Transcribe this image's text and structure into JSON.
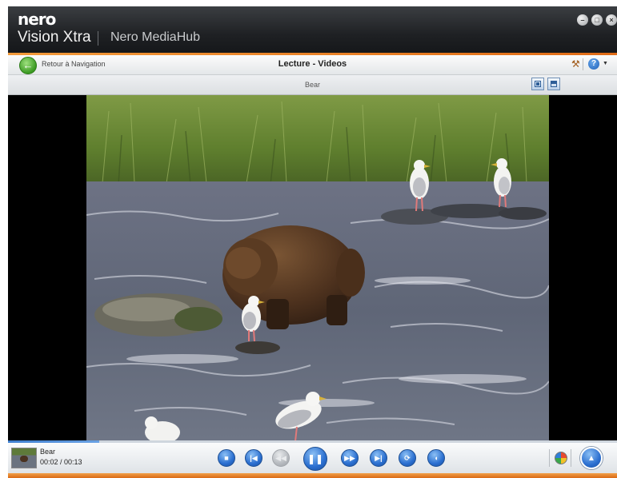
{
  "titlebar": {
    "logo": "nero",
    "product": "Vision Xtra",
    "app": "Nero MediaHub",
    "window_controls": [
      "minimize-icon",
      "maximize-icon",
      "close-icon"
    ]
  },
  "navbar": {
    "back_label": "Retour à Navigation",
    "title": "Lecture - Videos",
    "tool_icon": "hammer-icon",
    "help_icon": "help-icon"
  },
  "subbar": {
    "video_name": "Bear",
    "view_buttons": [
      "fullscreen-icon",
      "fit-window-icon"
    ]
  },
  "player": {
    "clip_title": "Bear",
    "time": "00:02 / 00:13",
    "progress": 0.15,
    "controls": [
      {
        "name": "stop-button",
        "icon": "stop-icon",
        "glyph": "■",
        "enabled": true
      },
      {
        "name": "previous-button",
        "icon": "skip-back-icon",
        "glyph": "⏮",
        "enabled": true
      },
      {
        "name": "rewind-button",
        "icon": "rewind-icon",
        "glyph": "⏪",
        "enabled": false
      },
      {
        "name": "pause-button",
        "icon": "pause-icon",
        "glyph": "❚❚",
        "enabled": true
      },
      {
        "name": "forward-button",
        "icon": "fast-forward-icon",
        "glyph": "⏩",
        "enabled": true
      },
      {
        "name": "next-button",
        "icon": "skip-forward-icon",
        "glyph": "⏭",
        "enabled": true
      },
      {
        "name": "repeat-button",
        "icon": "repeat-icon",
        "glyph": "⟳",
        "enabled": true
      },
      {
        "name": "volume-button",
        "icon": "volume-icon",
        "glyph": "◖",
        "enabled": true
      }
    ],
    "eject_icon": "eject-icon"
  },
  "colors": {
    "accent_orange": "#e8801f",
    "control_blue": "#2b6fd0",
    "titlebar": "#1f2124"
  }
}
